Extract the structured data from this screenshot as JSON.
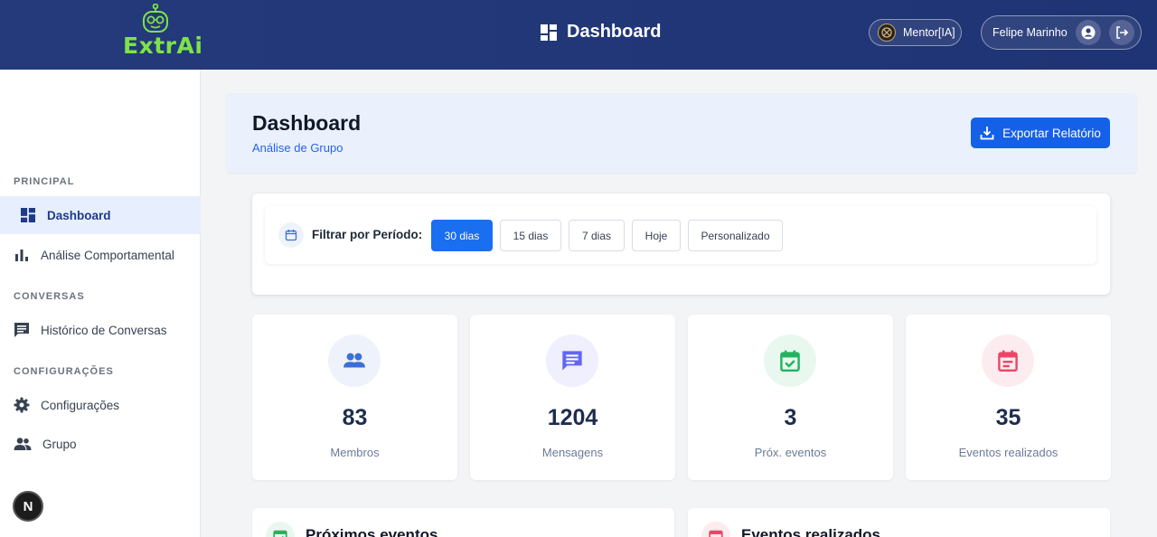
{
  "app": {
    "logo_text": "ExtrAi",
    "page_title": "Dashboard"
  },
  "topbar": {
    "mentor_label": "Mentor[IA]",
    "user_name": "Felipe Marinho"
  },
  "sidebar": {
    "sections": {
      "principal": "PRINCIPAL",
      "conversas": "CONVERSAS",
      "configuracoes": "CONFIGURAÇÕES"
    },
    "items": [
      {
        "label": "Dashboard",
        "icon": "dashboard-icon",
        "active": true
      },
      {
        "label": "Análise Comportamental",
        "icon": "bar-chart-icon"
      },
      {
        "label": "Histórico de Conversas",
        "icon": "chat-icon"
      },
      {
        "label": "Configurações",
        "icon": "gear-icon"
      },
      {
        "label": "Grupo",
        "icon": "group-icon"
      }
    ],
    "badge_letter": "N"
  },
  "header": {
    "title": "Dashboard",
    "subtitle": "Análise de Grupo",
    "export_label": "Exportar Relatório"
  },
  "filter": {
    "label": "Filtrar por Período:",
    "options": [
      "30 dias",
      "15 dias",
      "7 dias",
      "Hoje",
      "Personalizado"
    ],
    "selected": "30 dias"
  },
  "stats": [
    {
      "value": "83",
      "label": "Membros",
      "icon": "group-icon",
      "color": "#3b6fd8",
      "bg": "#eef2fb"
    },
    {
      "value": "1204",
      "label": "Mensagens",
      "icon": "message-icon",
      "color": "#6366f1",
      "bg": "#efeffd"
    },
    {
      "value": "3",
      "label": "Próx. eventos",
      "icon": "calendar-check-icon",
      "color": "#22b35e",
      "bg": "#e9f8ef"
    },
    {
      "value": "35",
      "label": "Eventos realizados",
      "icon": "calendar-icon",
      "color": "#ef4465",
      "bg": "#fdecef"
    }
  ],
  "panels": {
    "upcoming_title": "Próximos eventos",
    "done_title": "Eventos realizados"
  },
  "colors": {
    "topbar": "#243a7a",
    "accent": "#1a6ff0",
    "logo_green": "#7ee24a"
  }
}
